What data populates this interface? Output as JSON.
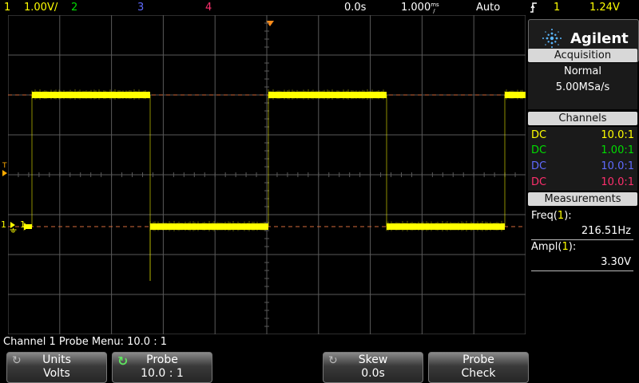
{
  "topbar": {
    "ch1_label": "1",
    "ch1_scale": "1.00V/",
    "ch2_label": "2",
    "ch3_label": "3",
    "ch4_label": "4",
    "time_delay": "0.0s",
    "time_scale": "1.000",
    "time_unit_top": "ms",
    "time_unit_bot": "/",
    "trigger_mode": "Auto",
    "trigger_icon": "trigger-edge-icon",
    "trigger_source": "1",
    "trigger_level": "1.24V"
  },
  "colors": {
    "ch1": "#ffff00",
    "ch2": "#00dd00",
    "ch3": "#5f6bff",
    "ch4": "#ff2f6d",
    "grid": "#5a5a5a",
    "reference_line": "#ff6a3a"
  },
  "panel": {
    "brand": "Agilent",
    "acquisition": {
      "title": "Acquisition",
      "mode": "Normal",
      "rate": "5.00MSa/s"
    },
    "channels": {
      "title": "Channels",
      "rows": [
        {
          "coupling": "DC",
          "ratio": "10.0:1"
        },
        {
          "coupling": "DC",
          "ratio": "1.00:1"
        },
        {
          "coupling": "DC",
          "ratio": "10.0:1"
        },
        {
          "coupling": "DC",
          "ratio": "10.0:1"
        }
      ]
    },
    "measurements": {
      "title": "Measurements",
      "items": [
        {
          "label": "Freq(",
          "channel": "1",
          "close": "):",
          "value": "216.51Hz"
        },
        {
          "label": "Ampl(",
          "channel": "1",
          "close": "):",
          "value": "3.30V"
        }
      ]
    }
  },
  "scope": {
    "trigger_marker": "T",
    "ch1_ground_marker": "1",
    "ch1_level_marker": "1"
  },
  "menu": {
    "title": "Channel 1 Probe Menu: 10.0 : 1",
    "softkeys": [
      {
        "line1": "Units",
        "line2": "Volts",
        "icon": "rotate-knob-icon"
      },
      {
        "line1": "Probe",
        "line2": "10.0 : 1",
        "icon": "rotate-knob-active-icon"
      },
      {
        "line1": "Skew",
        "line2": "0.0s",
        "icon": "rotate-knob-icon"
      },
      {
        "line1": "Probe",
        "line2": "Check",
        "icon": ""
      }
    ]
  }
}
